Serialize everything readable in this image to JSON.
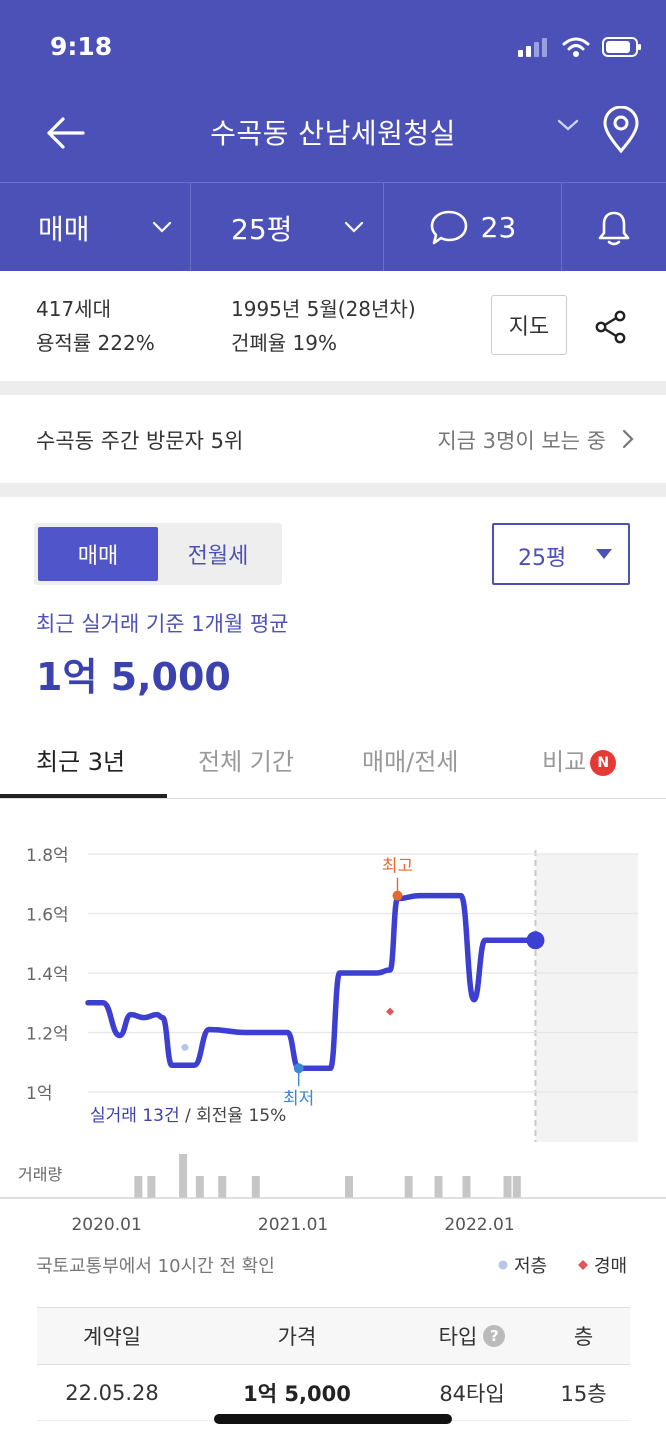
{
  "status": {
    "time": "9:18"
  },
  "nav": {
    "title": "수곡동 산남세원청실"
  },
  "subbar": {
    "trade": "매매",
    "size": "25평",
    "comments": "23"
  },
  "info": {
    "households": "417세대",
    "floor_area_ratio": "용적률 222%",
    "built": "1995년 5월(28년차)",
    "coverage_ratio": "건폐율 19%",
    "map_button": "지도"
  },
  "visitor": {
    "rank": "수곡동 주간 방문자 5위",
    "now": "지금 3명이 보는 중"
  },
  "price": {
    "segment": [
      "매매",
      "전월세"
    ],
    "size_select": "25평",
    "avg_label": "최근 실거래 기준 1개월 평균",
    "avg_value": "1억 5,000"
  },
  "tabs": [
    {
      "label": "최근 3년"
    },
    {
      "label": "전체 기간"
    },
    {
      "label": "매매/전세"
    },
    {
      "label": "비교",
      "badge": "N"
    }
  ],
  "chart_data": {
    "type": "line",
    "ylabels": [
      "1.8억",
      "1.6억",
      "1.4억",
      "1.2억",
      "1억"
    ],
    "yticks": [
      1.8,
      1.6,
      1.4,
      1.2,
      1.0
    ],
    "ylim": [
      1.0,
      1.8
    ],
    "xlabels": [
      "2020.01",
      "2021.01",
      "2022.01"
    ],
    "x_label_positions": [
      2020.0,
      2021.0,
      2022.0
    ],
    "xlim": [
      2019.9,
      2022.85
    ],
    "series": [
      {
        "values": [
          [
            2019.9,
            1.3
          ],
          [
            2019.98,
            1.3
          ],
          [
            2020.07,
            1.19
          ],
          [
            2020.13,
            1.26
          ],
          [
            2020.2,
            1.25
          ],
          [
            2020.27,
            1.26
          ],
          [
            2020.3,
            1.25
          ],
          [
            2020.35,
            1.09
          ],
          [
            2020.47,
            1.09
          ],
          [
            2020.55,
            1.21
          ],
          [
            2020.75,
            1.2
          ],
          [
            2020.9,
            1.2
          ],
          [
            2020.97,
            1.2
          ],
          [
            2021.03,
            1.08
          ],
          [
            2021.2,
            1.08
          ],
          [
            2021.25,
            1.4
          ],
          [
            2021.45,
            1.4
          ],
          [
            2021.52,
            1.41
          ],
          [
            2021.56,
            1.65
          ],
          [
            2021.68,
            1.66
          ],
          [
            2021.85,
            1.66
          ],
          [
            2021.9,
            1.66
          ],
          [
            2021.97,
            1.31
          ],
          [
            2022.03,
            1.51
          ],
          [
            2022.2,
            1.51
          ],
          [
            2022.3,
            1.51
          ]
        ]
      }
    ],
    "current": {
      "x": 2022.3,
      "y": 1.51
    },
    "forecast_start": 2022.3,
    "annotations": [
      {
        "text": "최고",
        "x": 2021.56,
        "y": 1.66,
        "color": "#e8692e"
      },
      {
        "text": "최저",
        "x": 2021.03,
        "y": 1.08,
        "color": "#3b88d6"
      }
    ],
    "markers": [
      {
        "kind": "저층",
        "x": 2020.42,
        "y": 1.15,
        "color": "#b6c8e8"
      },
      {
        "kind": "경매",
        "x": 2021.52,
        "y": 1.27,
        "color": "#e0555a"
      }
    ],
    "volume": [
      [
        2020.17,
        1
      ],
      [
        2020.24,
        1
      ],
      [
        2020.41,
        2
      ],
      [
        2020.5,
        1
      ],
      [
        2020.62,
        1
      ],
      [
        2020.8,
        1
      ],
      [
        2021.3,
        1
      ],
      [
        2021.62,
        1
      ],
      [
        2021.78,
        1
      ],
      [
        2021.93,
        1
      ],
      [
        2022.15,
        1
      ],
      [
        2022.2,
        1
      ]
    ],
    "volume_label": "거래량",
    "summary": "실거래 13건 / 회전율 15%",
    "colors": {
      "line": "#3c3fcf",
      "grid": "#e6e6e6"
    }
  },
  "source": {
    "text": "국토교통부에서 10시간 전 확인"
  },
  "legend": [
    {
      "label": "저층",
      "color": "#b6c8e8"
    },
    {
      "label": "경매",
      "color": "#e0555a"
    }
  ],
  "table": {
    "headers": [
      "계약일",
      "가격",
      "타입",
      "층"
    ],
    "rows": [
      [
        "22.05.28",
        "1억 5,000",
        "84타입",
        "15층"
      ]
    ]
  },
  "colors": {
    "brand": "#4c51b8",
    "accent": "#3c41b0"
  }
}
